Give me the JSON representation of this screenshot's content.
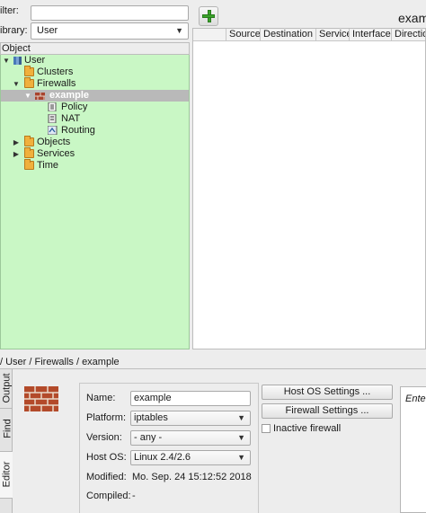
{
  "left_panel": {
    "filter_label": "ilter:",
    "filter_value": "",
    "library_label": "ibrary:",
    "library_value": "User",
    "tree_header": "Object",
    "tree": [
      {
        "label": "User"
      },
      {
        "label": "Clusters"
      },
      {
        "label": "Firewalls"
      },
      {
        "label": "example"
      },
      {
        "label": "Policy"
      },
      {
        "label": "NAT"
      },
      {
        "label": "Routing"
      },
      {
        "label": "Objects"
      },
      {
        "label": "Services"
      },
      {
        "label": "Time"
      }
    ]
  },
  "right_panel": {
    "firewall_title": "exam",
    "columns": [
      "",
      "Source",
      "Destination",
      "Service",
      "Interface",
      "Directio"
    ]
  },
  "path": "/ User / Firewalls / example",
  "bottom": {
    "tabs": [
      "Output",
      "Find",
      "Editor"
    ],
    "form": {
      "name_label": "Name:",
      "name_value": "example",
      "platform_label": "Platform:",
      "platform_value": "iptables",
      "version_label": "Version:",
      "version_value": "- any -",
      "hostos_label": "Host OS:",
      "hostos_value": "Linux 2.4/2.6",
      "modified_label": "Modified:",
      "modified_value": "Mo. Sep. 24 15:12:52 2018",
      "compiled_label": "Compiled:",
      "compiled_value": "-"
    },
    "host_os_settings_button": "Host OS Settings ...",
    "firewall_settings_button": "Firewall Settings ...",
    "inactive_label": "Inactive firewall",
    "inactive_checked": false,
    "comment_placeholder": "Ente"
  },
  "colors": {
    "tree_bg": "#c9f7c5",
    "selection_bg": "#b9b9b9",
    "add_green": "#3aa32a",
    "folder": "#f0b03c"
  }
}
